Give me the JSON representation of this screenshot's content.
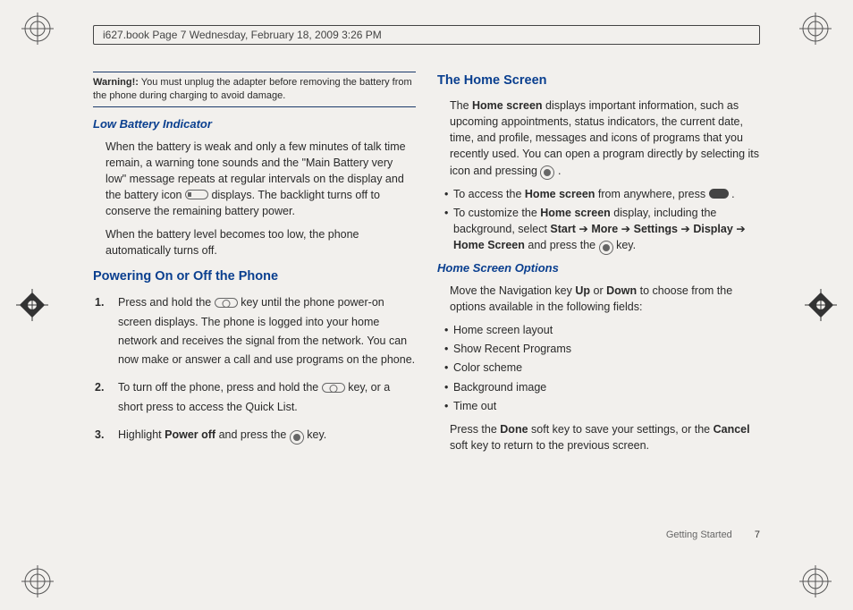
{
  "header": {
    "stamp": "i627.book  Page 7  Wednesday, February 18, 2009  3:26 PM"
  },
  "left": {
    "warning_label": "Warning!:",
    "warning_text": "You must unplug the adapter before removing the battery from the phone during charging to avoid damage.",
    "h_low_batt": "Low Battery Indicator",
    "p_low_batt_1a": "When the battery is weak and only a few minutes of talk time remain, a warning tone sounds and the \"Main Battery very low\" message repeats at regular intervals on the display and the battery icon ",
    "p_low_batt_1b": " displays. The backlight turns off to conserve the remaining battery power.",
    "p_low_batt_2": "When the battery level becomes too low, the phone automatically turns off.",
    "h_power": "Powering On or Off the Phone",
    "ol": {
      "n1": "1.",
      "t1a": "Press and hold the ",
      "t1b": " key until the phone power-on screen displays. The phone is logged into your home network and receives the signal from the network. You can now make or answer a call and use programs on the phone.",
      "n2": "2.",
      "t2a": "To turn off the phone, press and hold the ",
      "t2b": " key, or a short press to access the Quick List.",
      "n3": "3.",
      "t3a": "Highlight ",
      "t3b": "Power off",
      "t3c": " and press the ",
      "t3d": " key."
    }
  },
  "right": {
    "h_home": "The Home Screen",
    "p_home_1a": "The ",
    "p_home_1b": "Home screen",
    "p_home_1c": " displays important information, such as upcoming appointments, status indicators, the current date, time, and profile, messages and icons of programs that you recently used. You can open a program directly by selecting its icon and pressing ",
    "p_home_1d": ".",
    "bul": {
      "b1a": "To access the ",
      "b1b": "Home screen",
      "b1c": " from anywhere, press ",
      "b1d": " .",
      "b2a": "To customize the ",
      "b2b": "Home screen",
      "b2c": " display, including the background, select ",
      "b2d": "Start",
      "arrow": " ➔ ",
      "b2e": "More",
      "b2f": "Settings",
      "b2g": "Display",
      "b2h": "Home Screen",
      "b2i": " and press the ",
      "b2j": " key."
    },
    "h_opts": "Home Screen Options",
    "p_opts_1a": "Move the Navigation key ",
    "p_opts_1b": "Up",
    "p_opts_1c": " or ",
    "p_opts_1d": "Down",
    "p_opts_1e": " to choose from the options available in the following fields:",
    "opts": {
      "o1": "Home screen layout",
      "o2": "Show Recent Programs",
      "o3": "Color scheme",
      "o4": "Background image",
      "o5": "Time out"
    },
    "p_done_a": "Press the ",
    "p_done_b": "Done",
    "p_done_c": " soft key to save your settings, or the ",
    "p_done_d": "Cancel",
    "p_done_e": " soft key to return to the previous screen."
  },
  "footer": {
    "section": "Getting Started",
    "page": "7"
  }
}
